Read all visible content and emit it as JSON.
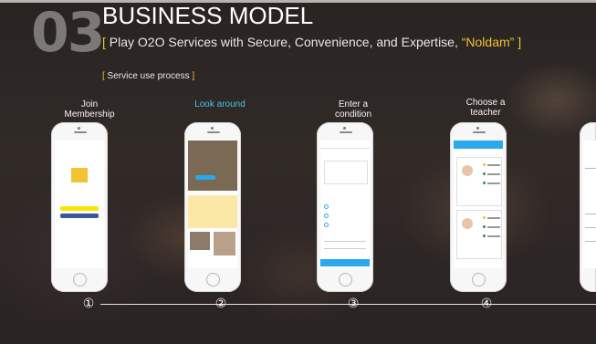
{
  "header": {
    "number": "03",
    "title": "BUSINESS MODEL",
    "subtitle_open": "[ ",
    "subtitle_text": "Play O2O Services with Secure, Convenience, and Expertise, ",
    "subtitle_brand": "“Noldam”",
    "subtitle_close": " ]",
    "section_label": "[ Service use process ]"
  },
  "steps": [
    {
      "label_line1": "Join",
      "label_line2": "Membership",
      "number": "①"
    },
    {
      "label_line1": "Look around",
      "label_line2": "",
      "number": "②"
    },
    {
      "label_line1": "Enter a",
      "label_line2": "condition",
      "number": "③"
    },
    {
      "label_line1": "Choose a",
      "label_line2": "teacher",
      "number": "④"
    }
  ],
  "colors": {
    "accent_yellow": "#f1c232",
    "accent_blue": "#4cc3e6",
    "app_blue": "#2aa9ee"
  }
}
